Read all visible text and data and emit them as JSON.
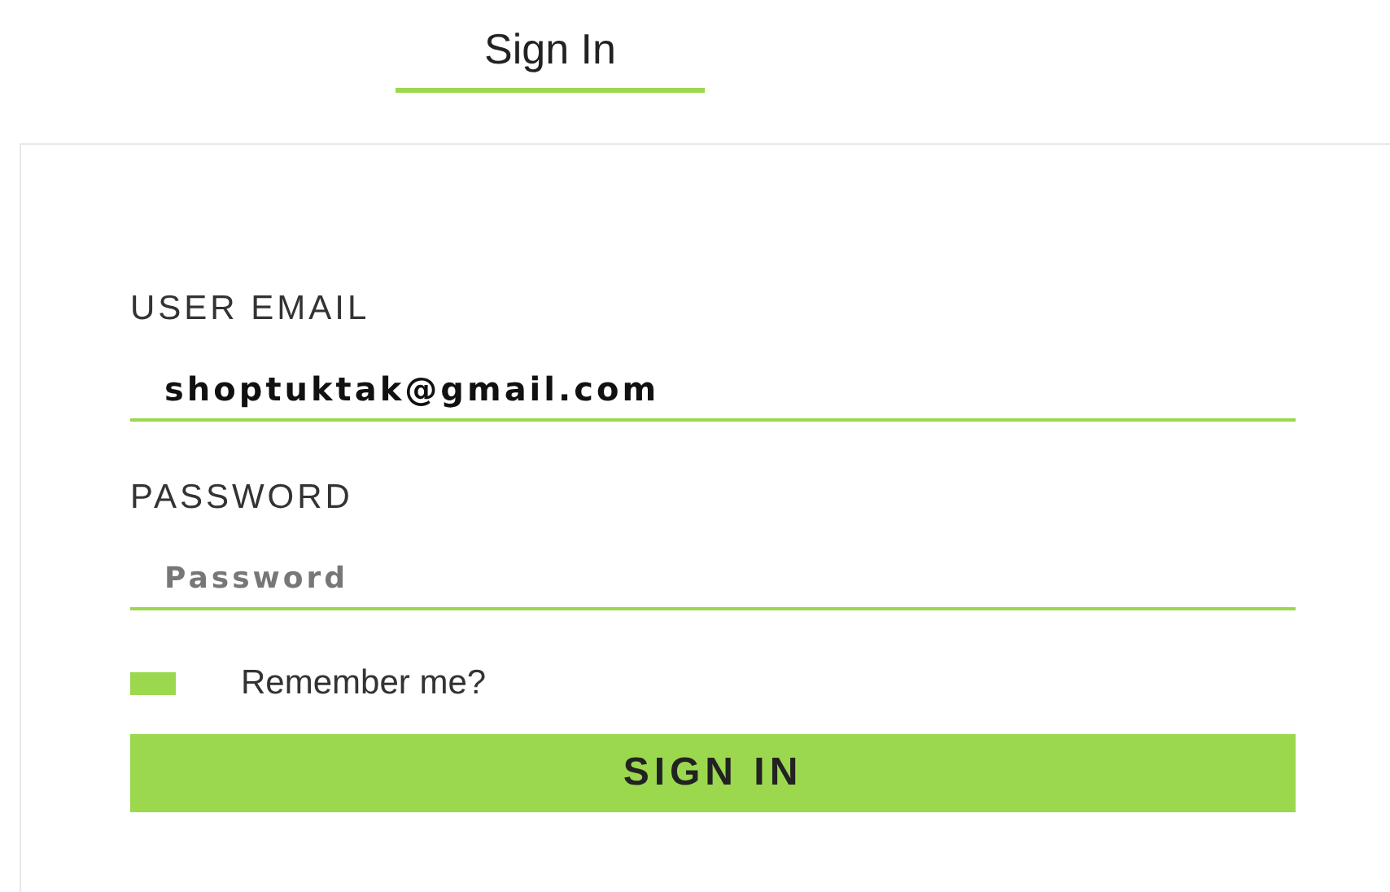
{
  "tabs": [
    {
      "label": "Sign In",
      "selected": true
    }
  ],
  "form": {
    "email": {
      "label": "USER EMAIL",
      "value": "shoptuktak@gmail.com"
    },
    "password": {
      "label": "PASSWORD",
      "placeholder": "Password"
    },
    "remember": {
      "label": "Remember me?",
      "checked": false
    },
    "submit": "SIGN IN"
  }
}
